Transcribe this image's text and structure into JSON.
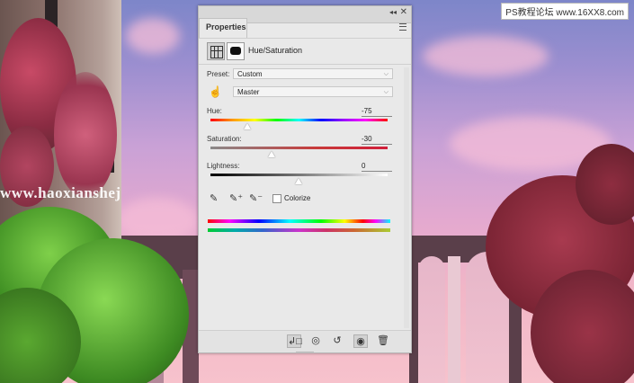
{
  "watermark": {
    "site_text": "www.haoxianshej",
    "badge_text": "PS教程论坛  www.16XX8.com"
  },
  "panel": {
    "tab_label": "Properties",
    "title": "Hue/Saturation",
    "preset_label": "Preset:",
    "preset_value": "Custom",
    "channel_value": "Master",
    "hue_label": "Hue:",
    "hue_value": "-75",
    "saturation_label": "Saturation:",
    "saturation_value": "-30",
    "lightness_label": "Lightness:",
    "lightness_value": "0",
    "colorize_label": "Colorize",
    "colorize_checked": false,
    "slider_levels": {
      "hue": -75,
      "saturation": -30,
      "lightness": 0
    }
  },
  "icons": {
    "adjustment": "hue-saturation-icon",
    "mask": "mask-icon",
    "hand": "targeted-adjustment-icon",
    "eyedropper": "eyedropper-icon",
    "eyedropper_add": "eyedropper-add-icon",
    "eyedropper_subtract": "eyedropper-subtract-icon",
    "clip": "clip-to-layer-icon",
    "view_previous": "view-previous-icon",
    "reset": "reset-icon",
    "visibility": "eye-icon",
    "delete": "trash-icon"
  },
  "colors": {
    "panel_bg": "#e9e9e9",
    "sky_top": "#7d86c9",
    "sky_bottom": "#f7c2cc"
  }
}
